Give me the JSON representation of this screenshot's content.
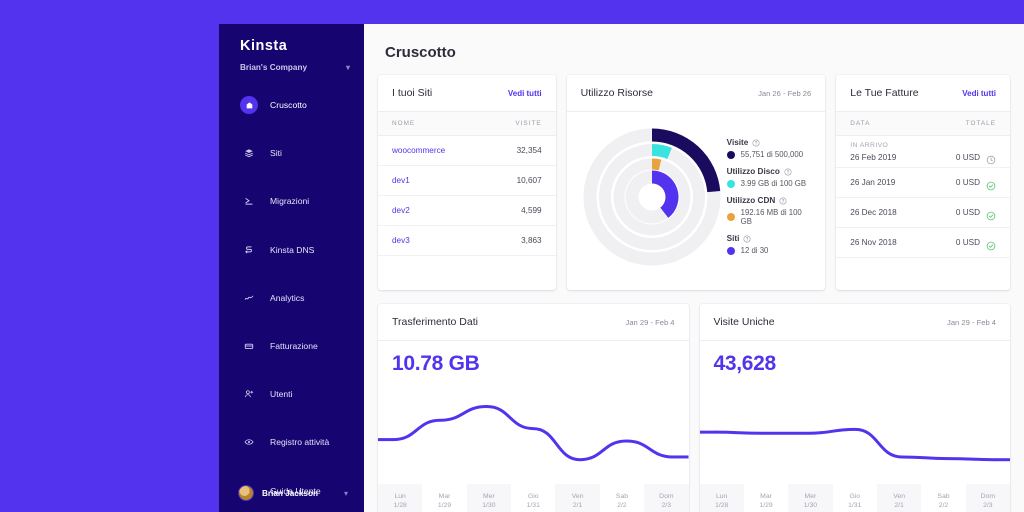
{
  "theme": {
    "backdrop": "#5333ED",
    "sidebar": "#160470",
    "accent": "#5333ED",
    "canvas": "#FAFAFB"
  },
  "sidebar": {
    "logo": "Kinsta",
    "company": "Brian's Company",
    "company_chevron": "chevron-down-icon",
    "items": [
      {
        "label": "Cruscotto",
        "icon": "home-icon",
        "active": true
      },
      {
        "label": "Siti",
        "icon": "sites-icon",
        "active": false
      },
      {
        "label": "Migrazioni",
        "icon": "migration-icon",
        "active": false
      },
      {
        "label": "Kinsta DNS",
        "icon": "dns-icon",
        "active": false
      },
      {
        "label": "Analytics",
        "icon": "analytics-icon",
        "active": false
      },
      {
        "label": "Fatturazione",
        "icon": "billing-icon",
        "active": false
      },
      {
        "label": "Utenti",
        "icon": "user-add-icon",
        "active": false
      },
      {
        "label": "Registro attività",
        "icon": "eye-icon",
        "active": false
      },
      {
        "label": "Guida Utente",
        "icon": "help-icon",
        "active": false
      }
    ],
    "user": {
      "name": "Brian Jackson",
      "chevron": "chevron-down-icon"
    }
  },
  "header": {
    "title": "Cruscotto"
  },
  "sites_card": {
    "title": "I tuoi Siti",
    "action": "Vedi tutti",
    "columns": {
      "name": "NOME",
      "visits": "VISITE"
    },
    "rows": [
      {
        "name": "woocommerce",
        "visits": "32,354"
      },
      {
        "name": "dev1",
        "visits": "10,607"
      },
      {
        "name": "dev2",
        "visits": "4,599"
      },
      {
        "name": "dev3",
        "visits": "3,863"
      }
    ]
  },
  "resources_card": {
    "title": "Utilizzo Risorse",
    "date_range": "Jan 26 - Feb 26",
    "legend": [
      {
        "label": "Visite",
        "value": "55,751 di 500,000",
        "color": "#1A0B5E",
        "help": "help-icon"
      },
      {
        "label": "Utilizzo Disco",
        "value": "3.99 GB di 100 GB",
        "color": "#3BE3E0",
        "help": "help-icon"
      },
      {
        "label": "Utilizzo CDN",
        "value": "192.16 MB di 100 GB",
        "color": "#E8A33D",
        "help": "help-icon"
      },
      {
        "label": "Siti",
        "value": "12 di 30",
        "color": "#5333ED",
        "help": "help-icon"
      }
    ],
    "chart_data": {
      "type": "pie",
      "title": "Utilizzo Risorse",
      "subtype": "radial-gauge",
      "track_color": "#F0F0F2",
      "rings": [
        {
          "name": "Visite",
          "used": 55751,
          "total": 500000,
          "percent": 11.2,
          "sweep_deg": 85,
          "color": "#1A0B5E",
          "radius": 62,
          "thickness": 13
        },
        {
          "name": "Utilizzo Disco",
          "used": 3.99,
          "total": 100,
          "percent": 3.99,
          "sweep_deg": 22,
          "color": "#3BE3E0",
          "radius": 47,
          "thickness": 12
        },
        {
          "name": "Utilizzo CDN",
          "used": 192.16,
          "total": 102400,
          "percent": 0.19,
          "sweep_deg": 14,
          "color": "#E8A33D",
          "radius": 33,
          "thickness": 11
        },
        {
          "name": "Siti",
          "used": 12,
          "total": 30,
          "percent": 40,
          "sweep_deg": 142,
          "color": "#5333ED",
          "radius": 20,
          "thickness": 13
        }
      ]
    }
  },
  "invoices_card": {
    "title": "Le Tue Fatture",
    "action": "Vedi tutti",
    "columns": {
      "date": "DATA",
      "total": "TOTALE"
    },
    "rows": [
      {
        "tag": "IN ARRIVO",
        "date": "26 Feb 2019",
        "amount": "0 USD",
        "status": "pending",
        "icon": "clock-icon"
      },
      {
        "tag": "",
        "date": "26 Jan 2019",
        "amount": "0 USD",
        "status": "paid",
        "icon": "check-circle-icon"
      },
      {
        "tag": "",
        "date": "26 Dec 2018",
        "amount": "0 USD",
        "status": "paid",
        "icon": "check-circle-icon"
      },
      {
        "tag": "",
        "date": "26 Nov 2018",
        "amount": "0 USD",
        "status": "paid",
        "icon": "check-circle-icon"
      }
    ]
  },
  "transfer_card": {
    "title": "Trasferimento Dati",
    "date_range": "Jan 29 - Feb 4",
    "value": "10.78 GB",
    "chart_data": {
      "type": "line",
      "title": "Trasferimento Dati",
      "xlabel": "",
      "ylabel": "",
      "grid": false,
      "legend": "none",
      "line_color": "#5333ED",
      "categories": [
        "Lun 1/28",
        "Mar 1/29",
        "Mer 1/30",
        "Gio 1/31",
        "Ven 2/1",
        "Sab 2/2",
        "Dom 2/3"
      ],
      "x": [
        0,
        1,
        2,
        3,
        4,
        5,
        6
      ],
      "values": [
        1.35,
        2.05,
        2.55,
        1.75,
        0.62,
        1.3,
        0.72
      ],
      "ylim": [
        0,
        3.2
      ]
    },
    "xaxis": [
      {
        "day": "Lun",
        "date": "1/28",
        "highlight": false
      },
      {
        "day": "Mar",
        "date": "1/29",
        "highlight": true
      },
      {
        "day": "Mer",
        "date": "1/30",
        "highlight": false
      },
      {
        "day": "Gio",
        "date": "1/31",
        "highlight": true
      },
      {
        "day": "Ven",
        "date": "2/1",
        "highlight": false
      },
      {
        "day": "Sab",
        "date": "2/2",
        "highlight": true
      },
      {
        "day": "Dom",
        "date": "2/3",
        "highlight": false
      }
    ]
  },
  "visits_card": {
    "title": "Visite Uniche",
    "date_range": "Jan 29 - Feb 4",
    "value": "43,628",
    "chart_data": {
      "type": "line",
      "title": "Visite Uniche",
      "xlabel": "",
      "ylabel": "",
      "grid": false,
      "legend": "none",
      "line_color": "#5333ED",
      "categories": [
        "Lun 1/28",
        "Mar 1/29",
        "Mer 1/30",
        "Gio 1/31",
        "Ven 2/1",
        "Sab 2/2",
        "Dom 2/3"
      ],
      "x": [
        0,
        1,
        2,
        3,
        4,
        5,
        6
      ],
      "values": [
        1.62,
        1.58,
        1.58,
        1.72,
        0.72,
        0.66,
        0.62
      ],
      "ylim": [
        0,
        3.2
      ]
    },
    "xaxis": [
      {
        "day": "Lun",
        "date": "1/28",
        "highlight": false
      },
      {
        "day": "Mar",
        "date": "1/29",
        "highlight": true
      },
      {
        "day": "Mer",
        "date": "1/30",
        "highlight": false
      },
      {
        "day": "Gio",
        "date": "1/31",
        "highlight": true
      },
      {
        "day": "Ven",
        "date": "2/1",
        "highlight": false
      },
      {
        "day": "Sab",
        "date": "2/2",
        "highlight": true
      },
      {
        "day": "Dom",
        "date": "2/3",
        "highlight": false
      }
    ]
  }
}
